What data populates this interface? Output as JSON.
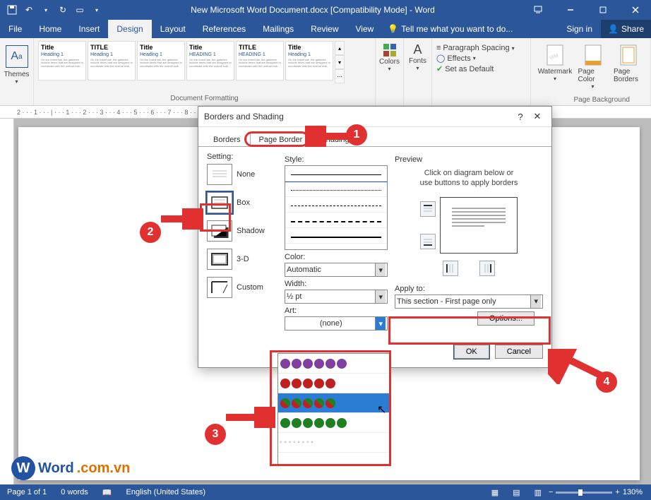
{
  "title": "New Microsoft Word Document.docx [Compatibility Mode] - Word",
  "menus": {
    "file": "File",
    "home": "Home",
    "insert": "Insert",
    "design": "Design",
    "layout": "Layout",
    "references": "References",
    "mailings": "Mailings",
    "review": "Review",
    "view": "View",
    "tellme": "Tell me what you want to do...",
    "signin": "Sign in",
    "share": "Share"
  },
  "ribbon": {
    "themes": "Themes",
    "colors": "Colors",
    "fonts": "Fonts",
    "paraspacing": "Paragraph Spacing",
    "effects": "Effects",
    "setdefault": "Set as Default",
    "watermark": "Watermark",
    "pagecolor": "Page Color",
    "pageborders": "Page Borders",
    "group_docfmt": "Document Formatting",
    "group_pagebg": "Page Background",
    "styles": [
      {
        "title": "Title",
        "heading": "Heading 1"
      },
      {
        "title": "TITLE",
        "heading": "Heading 1"
      },
      {
        "title": "Title",
        "heading": "Heading 1"
      },
      {
        "title": "Title",
        "heading": "HEADING 1"
      },
      {
        "title": "TITLE",
        "heading": "HEADING 1"
      },
      {
        "title": "Title",
        "heading": "Heading 1"
      }
    ]
  },
  "ruler": "2 · · · 1 · · · | · · · 1 · · · 2 · · · 3 · · · 4 · · · 5 · · · 6 · · · 7 · · · 8 · · · 9 · · · 10 · · · 11 · · · 12 · · · 13 · · · 14 · · · 15 · · · 16 · · · 17",
  "dialog": {
    "title": "Borders and Shading",
    "tabs": {
      "borders": "Borders",
      "pageborder": "Page Border",
      "shading": "Shading"
    },
    "setting_label": "Setting:",
    "settings": {
      "none": "None",
      "box": "Box",
      "shadow": "Shadow",
      "threeD": "3-D",
      "custom": "Custom"
    },
    "style_label": "Style:",
    "color_label": "Color:",
    "color_value": "Automatic",
    "width_label": "Width:",
    "width_value": "½ pt",
    "art_label": "Art:",
    "art_value": "(none)",
    "preview_label": "Preview",
    "preview_hint1": "Click on diagram below or",
    "preview_hint2": "use buttons to apply borders",
    "applyto_label": "Apply to:",
    "applyto_value": "This section - First page only",
    "options": "Options...",
    "ok": "OK",
    "cancel": "Cancel"
  },
  "status": {
    "page": "Page 1 of 1",
    "words": "0 words",
    "lang": "English (United States)",
    "zoom": "130%"
  },
  "logo": {
    "brand": "Word",
    "domain": ".com.vn"
  },
  "anno": {
    "1": "1",
    "2": "2",
    "3": "3",
    "4": "4"
  }
}
